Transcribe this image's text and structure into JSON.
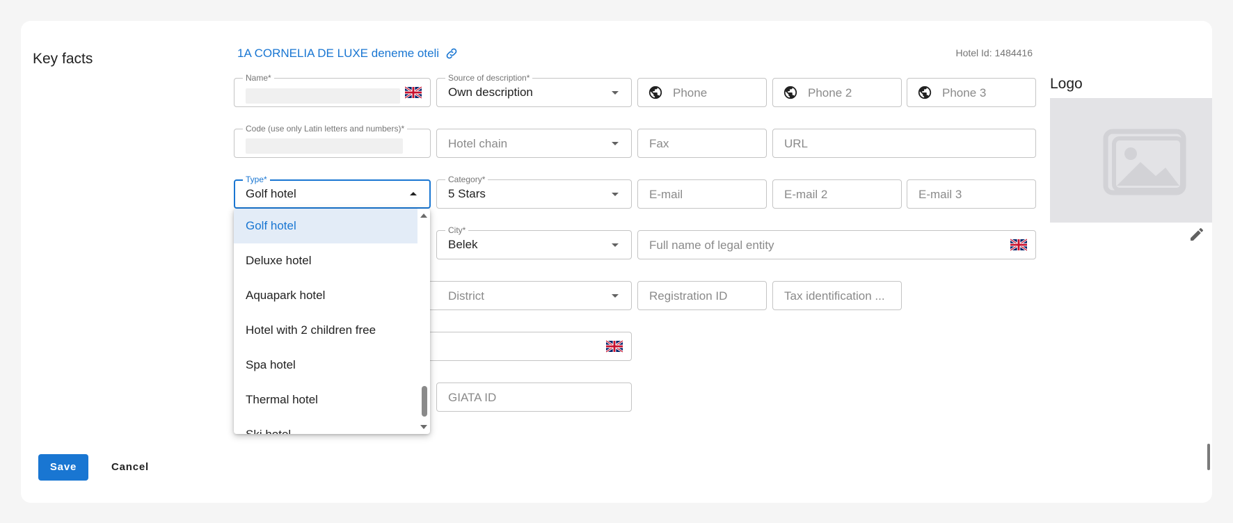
{
  "section": {
    "title": "Key facts"
  },
  "hotel": {
    "link_text": "1A CORNELIA DE LUXE deneme oteli",
    "id_text": "Hotel Id: 1484416"
  },
  "fields": {
    "name": {
      "label": "Name*",
      "value": ""
    },
    "source": {
      "label": "Source of description*",
      "value": "Own description"
    },
    "phone": {
      "placeholder": "Phone"
    },
    "phone2": {
      "placeholder": "Phone 2"
    },
    "phone3": {
      "placeholder": "Phone 3"
    },
    "code": {
      "label": "Code (use only Latin letters and numbers)*",
      "value": ""
    },
    "hotel_chain": {
      "placeholder": "Hotel chain"
    },
    "fax": {
      "placeholder": "Fax"
    },
    "url": {
      "placeholder": "URL"
    },
    "type": {
      "label": "Type*",
      "value": "Golf hotel"
    },
    "category": {
      "label": "Category*",
      "value": "5 Stars"
    },
    "email": {
      "placeholder": "E-mail"
    },
    "email2": {
      "placeholder": "E-mail 2"
    },
    "email3": {
      "placeholder": "E-mail 3"
    },
    "city": {
      "label": "City*",
      "value": "Belek"
    },
    "legal_entity": {
      "placeholder": "Full name of legal entity"
    },
    "district": {
      "placeholder": "District"
    },
    "registration_id": {
      "placeholder": "Registration ID"
    },
    "tax_id": {
      "placeholder": "Tax identification ..."
    },
    "giata_id": {
      "placeholder": "GIATA ID"
    }
  },
  "type_dropdown": {
    "options": [
      "Golf hotel",
      "Deluxe hotel",
      "Aquapark hotel",
      "Hotel with 2 children free",
      "Spa hotel",
      "Thermal hotel",
      "Ski hotel"
    ],
    "selected": "Golf hotel"
  },
  "logo": {
    "title": "Logo"
  },
  "actions": {
    "save": "Save",
    "cancel": "Cancel"
  },
  "icons": {
    "link": "link-icon",
    "globe": "globe-icon",
    "flag": "uk-flag-icon",
    "edit": "edit-pencil-icon",
    "image": "image-placeholder-icon"
  },
  "colors": {
    "accent": "#1976d2",
    "selected_bg": "#e3ecf7",
    "logo_bg": "#e3e3e6"
  }
}
